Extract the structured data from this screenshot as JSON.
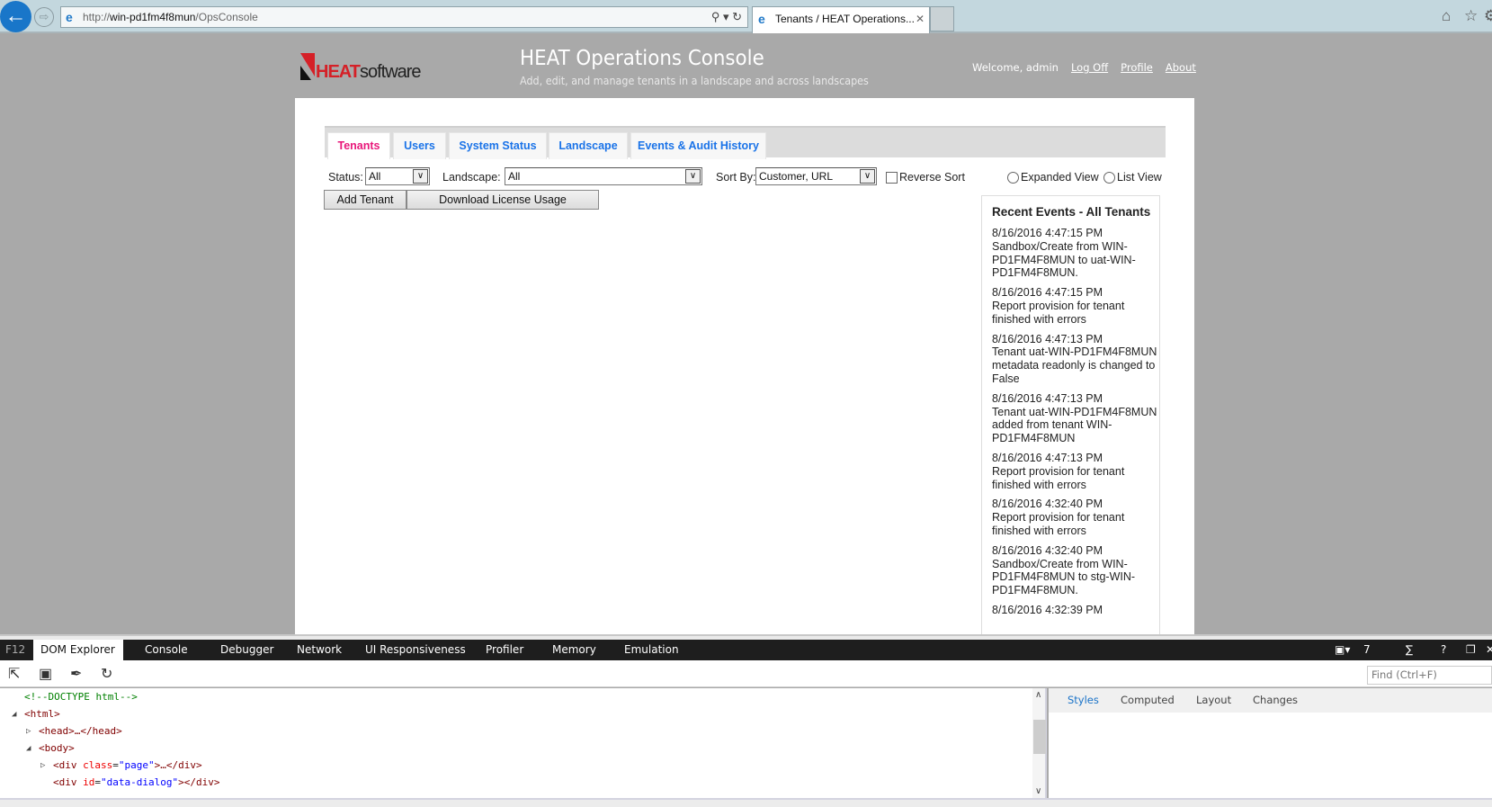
{
  "browser": {
    "url_prefix": "http://",
    "url_host": "win-pd1fm4f8mun",
    "url_path": "/OpsConsole",
    "tab_title": "Tenants / HEAT Operations..."
  },
  "header": {
    "logo_heat": "HEAT",
    "logo_software": "software",
    "title": "HEAT Operations Console",
    "subtitle": "Add, edit, and manage tenants in a landscape and across landscapes",
    "welcome": "Welcome, admin",
    "links": [
      "Log Off",
      "Profile",
      "About"
    ]
  },
  "tabs": [
    {
      "label": "Tenants",
      "active": true
    },
    {
      "label": "Users"
    },
    {
      "label": "System Status"
    },
    {
      "label": "Landscape"
    },
    {
      "label": "Events & Audit History"
    }
  ],
  "filters": {
    "status_label": "Status:",
    "status_value": "All",
    "landscape_label": "Landscape:",
    "landscape_value": "All",
    "sort_label": "Sort By:",
    "sort_value": "Customer, URL",
    "reverse_sort": "Reverse Sort",
    "expanded_view": "Expanded View",
    "list_view": "List View"
  },
  "buttons": {
    "add_tenant": "Add Tenant",
    "download_license": "Download License Usage"
  },
  "events": {
    "title": "Recent Events - All Tenants",
    "items": [
      {
        "time": "8/16/2016 4:47:15 PM",
        "text": "Sandbox/Create from WIN-PD1FM4F8MUN to uat-WIN-PD1FM4F8MUN."
      },
      {
        "time": "8/16/2016 4:47:15 PM",
        "text": "Report provision for tenant finished with errors"
      },
      {
        "time": "8/16/2016 4:47:13 PM",
        "text": "Tenant uat-WIN-PD1FM4F8MUN metadata readonly is changed to False"
      },
      {
        "time": "8/16/2016 4:47:13 PM",
        "text": "Tenant uat-WIN-PD1FM4F8MUN added from tenant WIN-PD1FM4F8MUN"
      },
      {
        "time": "8/16/2016 4:47:13 PM",
        "text": "Report provision for tenant finished with errors"
      },
      {
        "time": "8/16/2016 4:32:40 PM",
        "text": "Report provision for tenant finished with errors"
      },
      {
        "time": "8/16/2016 4:32:40 PM",
        "text": "Sandbox/Create from WIN-PD1FM4F8MUN to stg-WIN-PD1FM4F8MUN."
      },
      {
        "time": "8/16/2016 4:32:39 PM",
        "text": ""
      }
    ]
  },
  "devtools": {
    "f12": "F12",
    "tabs": [
      "DOM Explorer",
      "Console",
      "Debugger",
      "Network",
      "UI Responsiveness",
      "Profiler",
      "Memory",
      "Emulation"
    ],
    "doc_mode": "7",
    "find_placeholder": "Find (Ctrl+F)",
    "dom": {
      "doctype": "<!--DOCTYPE html-->",
      "html": "<html>",
      "head": "<head>…</head>",
      "body": "<body>",
      "div_open": "<div ",
      "class_attr": "class",
      "page_val": "\"page\"",
      "div_close": ">…</div>",
      "id_attr": "id",
      "dialog_val": "\"data-dialog\"",
      "dialog_close": "></div>"
    },
    "styles_tabs": [
      "Styles",
      "Computed",
      "Layout",
      "Changes"
    ]
  }
}
